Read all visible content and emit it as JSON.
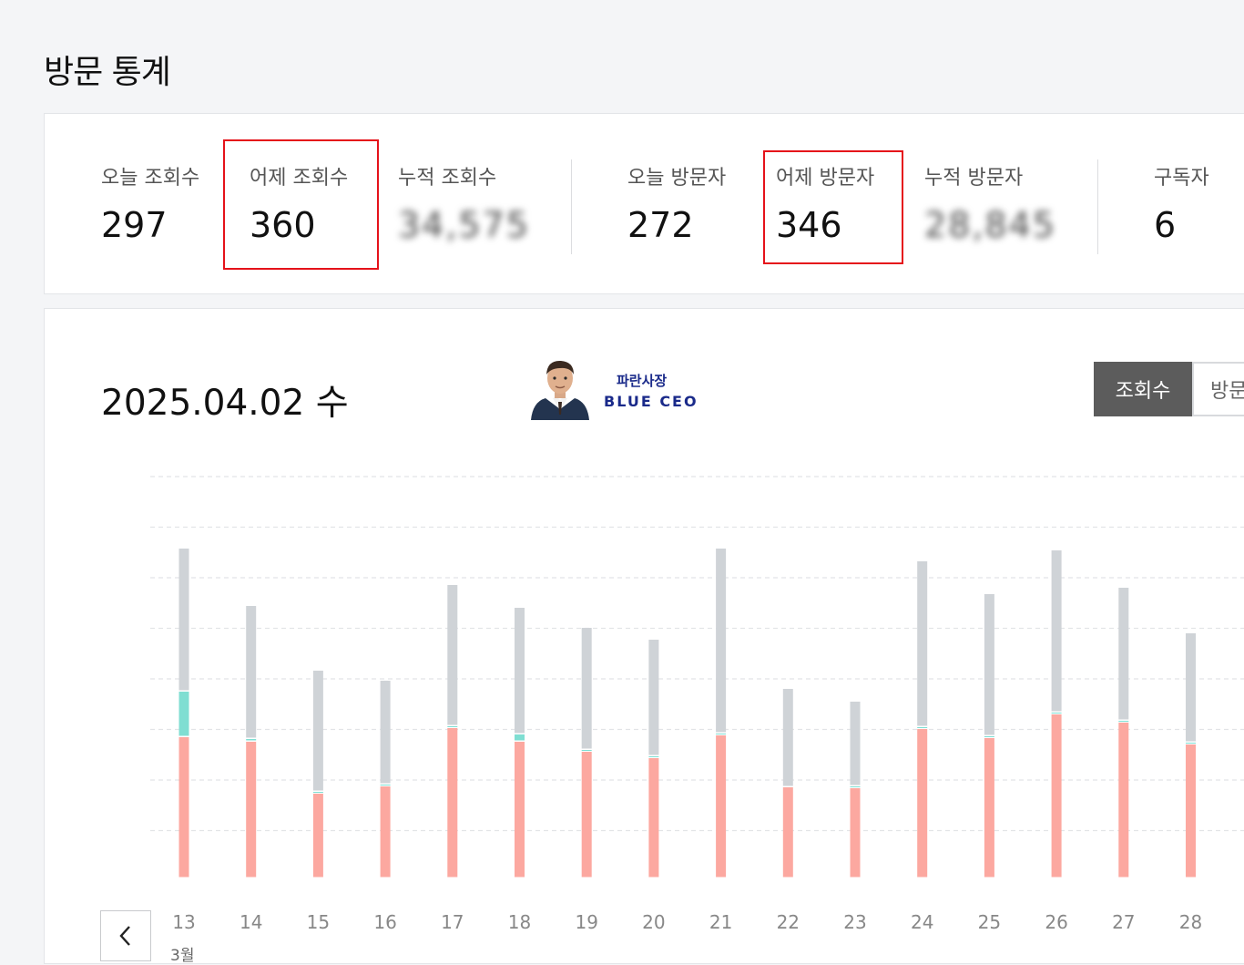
{
  "page": {
    "title": "방문 통계"
  },
  "stats": [
    {
      "label": "오늘 조회수",
      "value": "297"
    },
    {
      "label": "어제 조회수",
      "value": "360"
    },
    {
      "label": "누적 조회수",
      "value": "34,575"
    },
    {
      "label": "오늘 방문자",
      "value": "272"
    },
    {
      "label": "어제 방문자",
      "value": "346"
    },
    {
      "label": "누적 방문자",
      "value": "28,845"
    },
    {
      "label": "구독자",
      "value": "6"
    }
  ],
  "chart_header": {
    "date": "2025.04.02 수",
    "logo_text_ko": "파란사장",
    "logo_text_en": "BLUE CEO",
    "toggle_active": "조회수",
    "toggle_inactive": "방문자"
  },
  "chart_footer": {
    "month": "3월"
  },
  "colors": {
    "bar_gray": "#cfd3d7",
    "bar_teal": "#7fded2",
    "bar_salmon": "#fca8a0",
    "highlight_red": "#e5121a"
  },
  "chart_data": {
    "type": "bar",
    "stacked": true,
    "categories": [
      "13",
      "14",
      "15",
      "16",
      "17",
      "18",
      "19",
      "20",
      "21",
      "22",
      "23",
      "24",
      "25",
      "26",
      "27",
      "28"
    ],
    "series": [
      {
        "color": "salmon",
        "values": [
          155,
          150,
          93,
          101,
          165,
          150,
          139,
          132,
          157,
          100,
          99,
          164,
          154,
          180,
          171,
          147
        ]
      },
      {
        "color": "teal",
        "values": [
          50,
          3,
          2,
          2,
          2,
          8,
          2,
          2,
          2,
          0,
          2,
          2,
          2,
          2,
          2,
          2
        ]
      },
      {
        "color": "gray",
        "values": [
          157,
          146,
          133,
          114,
          155,
          139,
          134,
          128,
          203,
          108,
          93,
          182,
          156,
          178,
          146,
          120
        ]
      }
    ],
    "ylim": [
      0,
      400
    ],
    "grid": true
  }
}
